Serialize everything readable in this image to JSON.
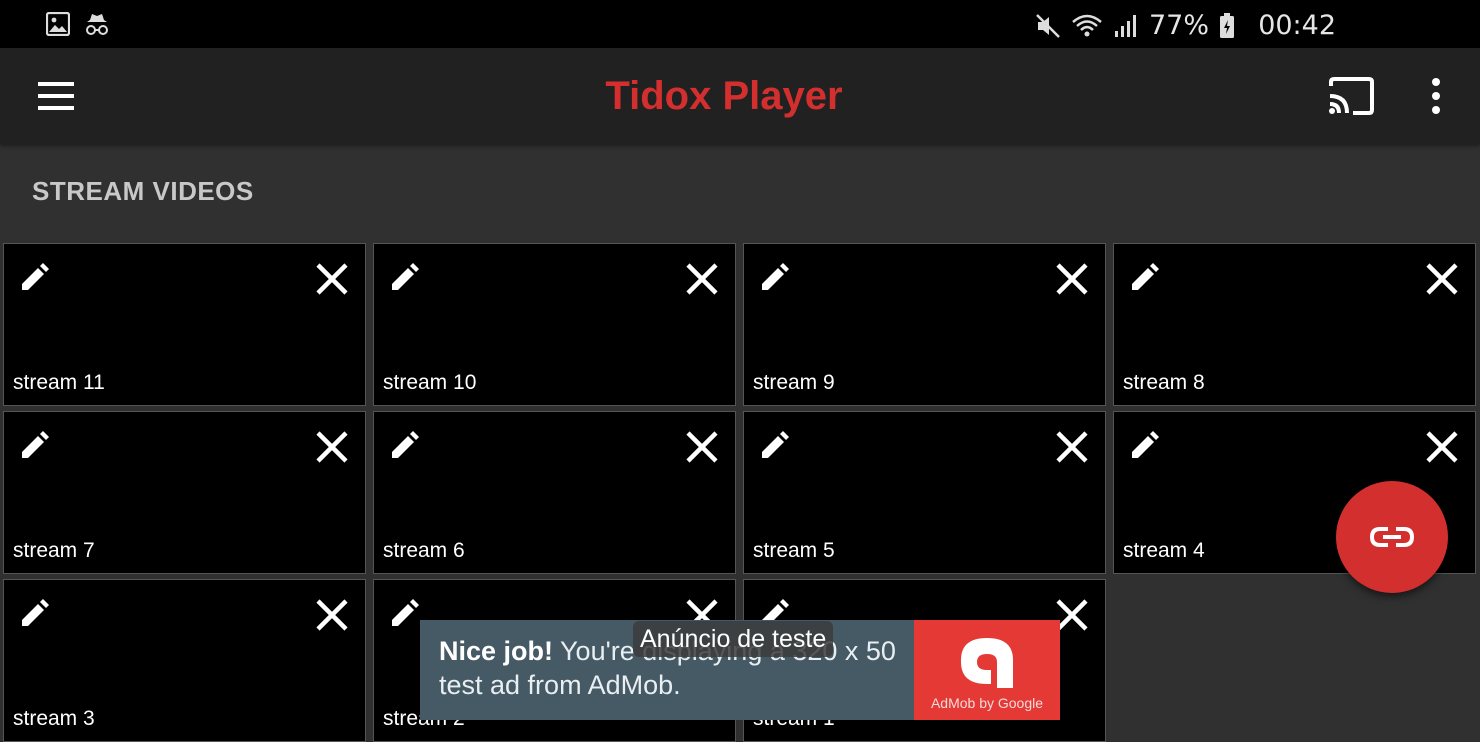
{
  "status_bar": {
    "left_icons": [
      "image-icon",
      "incognito-icon"
    ],
    "right_icons": [
      "mute-icon",
      "wifi-icon",
      "signal-icon",
      "battery-charging-icon"
    ],
    "battery": "77%",
    "time": "00:42"
  },
  "app_bar": {
    "title": "Tidox Player",
    "title_color": "#d32f2f",
    "left_icon": "menu-icon",
    "right_icons": [
      "cast-icon",
      "more-vert-icon"
    ]
  },
  "section": {
    "title": "STREAM VIDEOS"
  },
  "tiles": [
    {
      "label": "stream 11"
    },
    {
      "label": "stream 10"
    },
    {
      "label": "stream 9"
    },
    {
      "label": "stream 8"
    },
    {
      "label": "stream 7"
    },
    {
      "label": "stream 6"
    },
    {
      "label": "stream 5"
    },
    {
      "label": "stream 4"
    },
    {
      "label": "stream 3"
    },
    {
      "label": "stream 2"
    },
    {
      "label": "stream 1"
    }
  ],
  "tile_icons": {
    "edit": "pencil-icon",
    "remove": "close-icon"
  },
  "fab": {
    "icon": "link-icon",
    "color": "#d32f2f"
  },
  "ad": {
    "headline": "Nice job!",
    "body": " You're displaying a 320 x 50 test ad from AdMob.",
    "logo_caption": "AdMob by Google",
    "test_label": "Anúncio de teste",
    "background": "#455a64",
    "logo_color": "#e53935"
  }
}
